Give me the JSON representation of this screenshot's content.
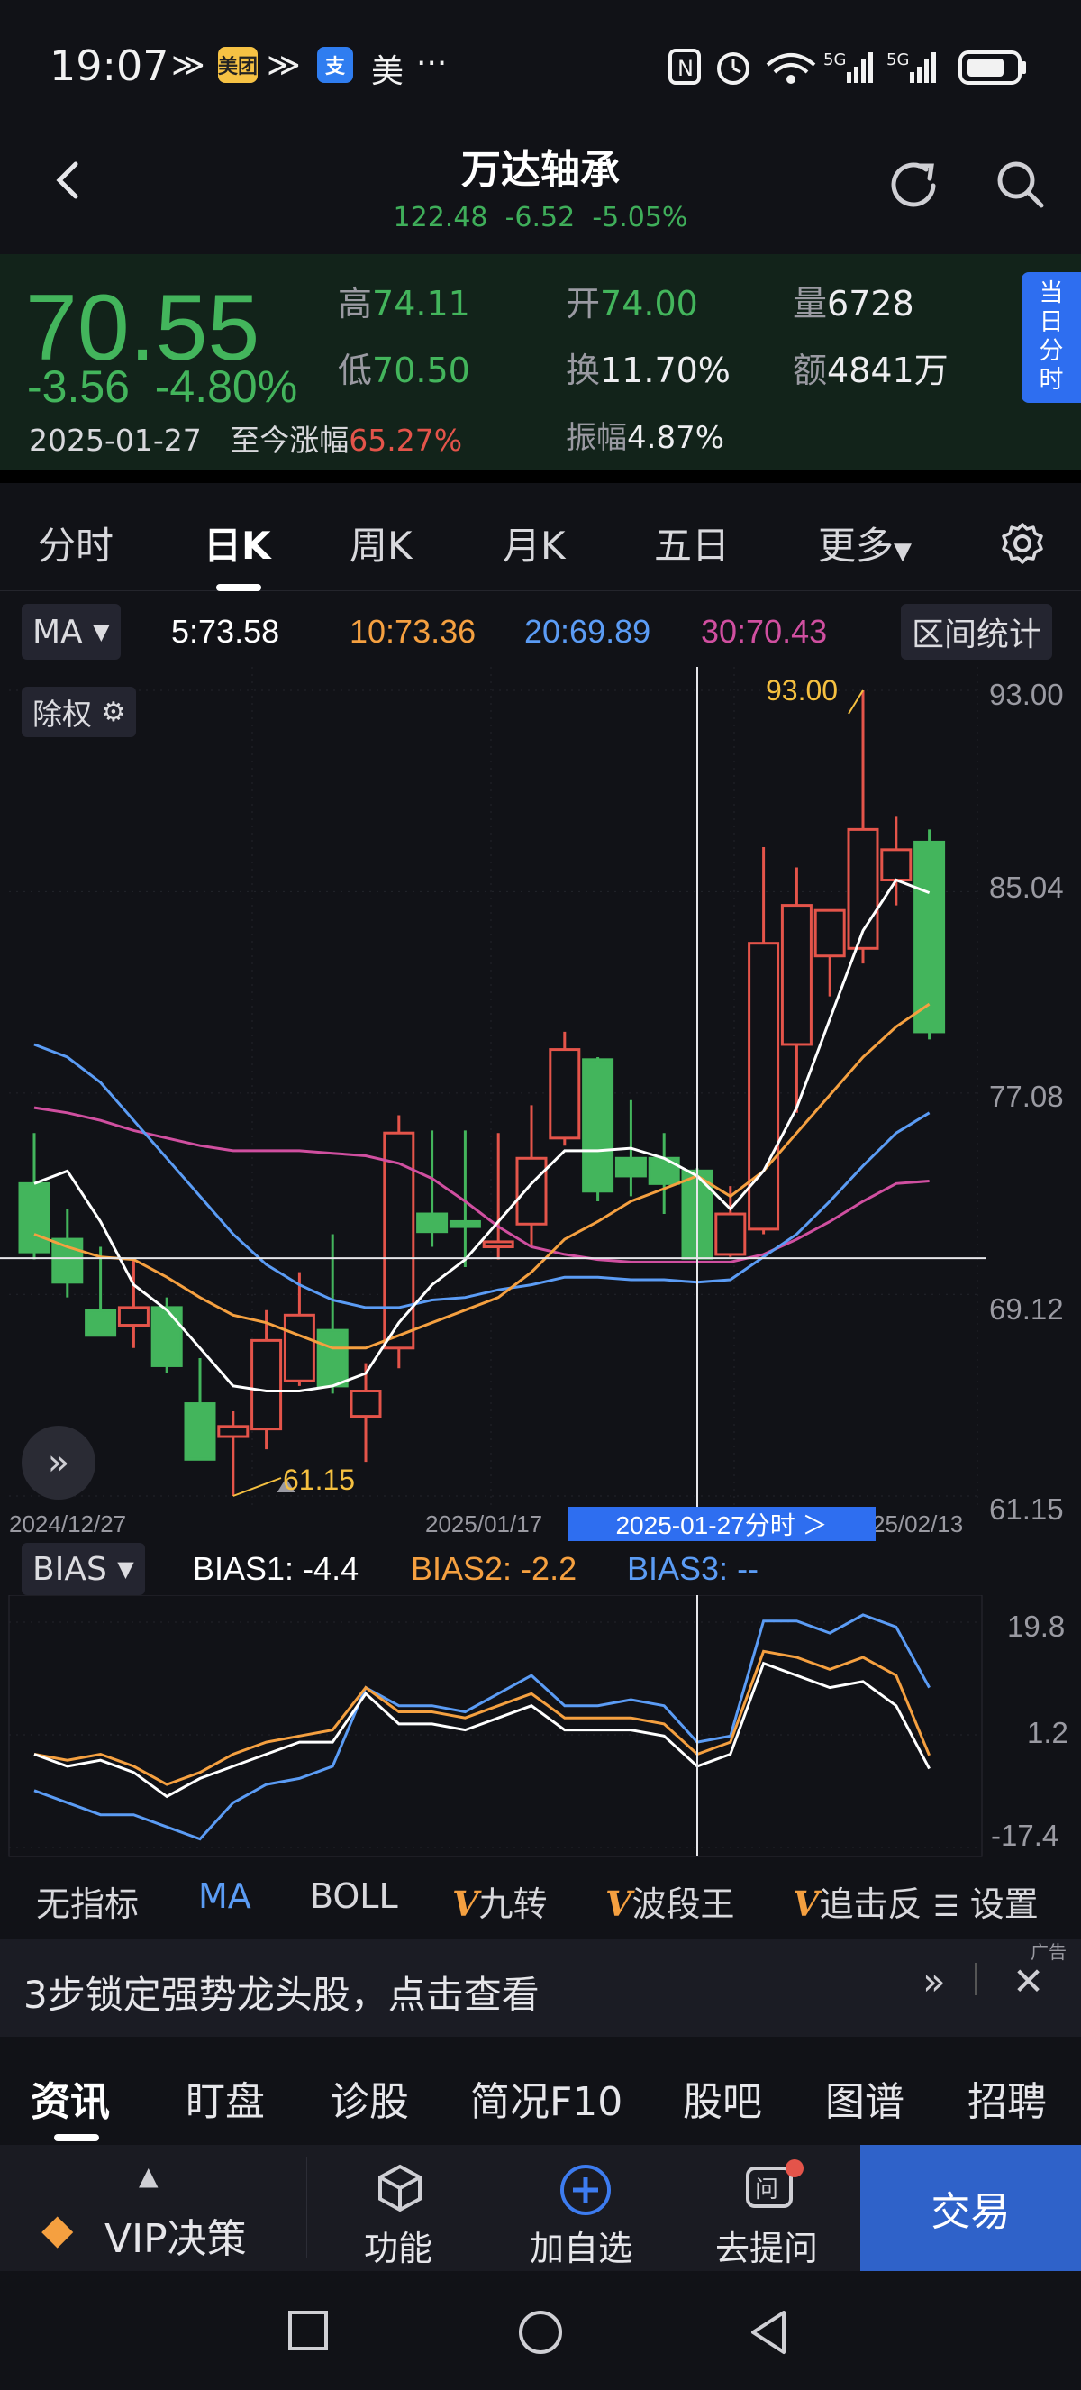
{
  "status_bar": {
    "time": "19:07",
    "app_badge_1": "美团",
    "app_badge_2": "支",
    "app_text": "美",
    "more": "···",
    "icons": [
      "nfc-icon",
      "alarm-icon",
      "wifi-icon",
      "signal-5g-icon",
      "signal-5g-icon",
      "battery-icon"
    ]
  },
  "header": {
    "stock_name": "万达轴承",
    "index_value": "122.48",
    "index_change": "-6.52",
    "index_pct": "-5.05%"
  },
  "quote": {
    "price": "70.55",
    "change": "-3.56",
    "change_pct": "-4.80%",
    "date": "2025-01-27",
    "since_label": "至今涨幅",
    "since_value": "65.27%",
    "high_label": "高",
    "high": "74.11",
    "low_label": "低",
    "low": "70.50",
    "open_label": "开",
    "open": "74.00",
    "turnover_label": "换",
    "turnover": "11.70%",
    "amplitude_label": "振幅",
    "amplitude": "4.87%",
    "volume_label": "量",
    "volume": "6728",
    "amount_label": "额",
    "amount": "4841万",
    "side_tab": [
      "当",
      "日",
      "分",
      "时"
    ]
  },
  "tabs": [
    "分时",
    "日K",
    "周K",
    "月K",
    "五日",
    "更多"
  ],
  "ma": {
    "selector": "MA",
    "ma5": "5:73.58",
    "ma10": "10:73.36",
    "ma20": "20:69.89",
    "ma30": "30:70.43",
    "range_stats": "区间统计"
  },
  "chart_controls": {
    "adjust": "除权",
    "max_label": "93.00",
    "min_label": "61.15",
    "date_start": "2024/12/27",
    "date_mid": "2025/01/17",
    "date_end": "25/02/13",
    "crosshair_date": "2025-01-27分时 ＞"
  },
  "price_axis": [
    "93.00",
    "85.04",
    "77.08",
    "69.12",
    "61.15"
  ],
  "bias": {
    "selector": "BIAS",
    "bias1": "BIAS1: -4.4",
    "bias2": "BIAS2: -2.2",
    "bias3": "BIAS3: --",
    "axis": [
      "19.8",
      "1.2",
      "-17.4"
    ]
  },
  "indicators": [
    "无指标",
    "MA",
    "BOLL",
    "九转",
    "波段王",
    "追击反",
    "设置"
  ],
  "ad": {
    "tag": "广告",
    "text": "3步锁定强势龙头股，点击查看"
  },
  "news_tabs": [
    "资讯",
    "盯盘",
    "诊股",
    "简况F10",
    "股吧",
    "图谱",
    "招聘"
  ],
  "bottom_bar": {
    "vip": "VIP决策",
    "func": "功能",
    "add": "加自选",
    "ask": "去提问",
    "trade": "交易"
  },
  "colors": {
    "up": "#e4544a",
    "down": "#43b55c",
    "ma5": "#ffffff",
    "ma10": "#f5a040",
    "ma20": "#5b9cf5",
    "ma30": "#d04fa0",
    "accent": "#2e6ef0"
  },
  "chart_data": {
    "type": "candlestick",
    "ylim": [
      61.15,
      93.0
    ],
    "candles": [
      {
        "o": 73.5,
        "h": 75.5,
        "l": 70.5,
        "c": 70.8
      },
      {
        "o": 71.3,
        "h": 72.5,
        "l": 69.0,
        "c": 69.6
      },
      {
        "o": 68.5,
        "h": 71.0,
        "l": 67.5,
        "c": 67.5
      },
      {
        "o": 67.9,
        "h": 70.5,
        "l": 67.0,
        "c": 68.6
      },
      {
        "o": 68.6,
        "h": 69.0,
        "l": 66.0,
        "c": 66.3
      },
      {
        "o": 64.8,
        "h": 66.6,
        "l": 62.6,
        "c": 62.6
      },
      {
        "o": 63.5,
        "h": 64.5,
        "l": 61.15,
        "c": 63.9
      },
      {
        "o": 63.8,
        "h": 68.5,
        "l": 63.0,
        "c": 67.3
      },
      {
        "o": 65.7,
        "h": 70.0,
        "l": 65.5,
        "c": 68.3
      },
      {
        "o": 67.7,
        "h": 71.5,
        "l": 65.2,
        "c": 65.5
      },
      {
        "o": 64.3,
        "h": 66.4,
        "l": 62.5,
        "c": 65.3
      },
      {
        "o": 67.0,
        "h": 76.2,
        "l": 66.2,
        "c": 75.5
      },
      {
        "o": 72.3,
        "h": 75.6,
        "l": 71.0,
        "c": 71.6
      },
      {
        "o": 72.0,
        "h": 75.6,
        "l": 70.2,
        "c": 71.8
      },
      {
        "o": 71.0,
        "h": 75.5,
        "l": 70.5,
        "c": 71.2
      },
      {
        "o": 71.9,
        "h": 76.6,
        "l": 71.0,
        "c": 74.5
      },
      {
        "o": 75.3,
        "h": 79.5,
        "l": 75.0,
        "c": 78.8
      },
      {
        "o": 78.4,
        "h": 78.5,
        "l": 72.8,
        "c": 73.2
      },
      {
        "o": 74.5,
        "h": 76.8,
        "l": 73.0,
        "c": 73.8
      },
      {
        "o": 74.5,
        "h": 75.5,
        "l": 72.3,
        "c": 73.5
      },
      {
        "o": 74.0,
        "h": 74.11,
        "l": 70.5,
        "c": 70.55
      },
      {
        "o": 70.7,
        "h": 73.4,
        "l": 70.6,
        "c": 72.3
      },
      {
        "o": 71.7,
        "h": 86.8,
        "l": 71.5,
        "c": 83.0
      },
      {
        "o": 79.0,
        "h": 86.0,
        "l": 76.3,
        "c": 84.5
      },
      {
        "o": 82.5,
        "h": 84.0,
        "l": 80.9,
        "c": 84.3
      },
      {
        "o": 82.8,
        "h": 93.0,
        "l": 82.2,
        "c": 87.5
      },
      {
        "o": 85.5,
        "h": 88.0,
        "l": 84.5,
        "c": 86.7
      },
      {
        "o": 87.0,
        "h": 87.5,
        "l": 79.2,
        "c": 79.5
      }
    ],
    "ma5": [
      73.5,
      74.0,
      72.0,
      69.5,
      68.5,
      67.0,
      65.5,
      65.3,
      65.3,
      65.5,
      66.0,
      68.0,
      69.5,
      70.5,
      72.0,
      73.5,
      74.8,
      74.8,
      74.9,
      74.5,
      73.8,
      72.5,
      74.0,
      76.5,
      80.0,
      83.5,
      85.5,
      85.0
    ],
    "ma10": [
      71.5,
      71.0,
      70.6,
      70.5,
      69.8,
      69.0,
      68.3,
      68.0,
      67.5,
      67.0,
      67.0,
      67.5,
      68.0,
      68.5,
      69.0,
      70.0,
      71.3,
      72.0,
      72.8,
      73.3,
      73.8,
      73.0,
      74.0,
      75.5,
      77.0,
      78.5,
      79.7,
      80.6
    ],
    "ma20": [
      79.0,
      78.5,
      77.5,
      76.0,
      74.5,
      73.0,
      71.5,
      70.3,
      69.5,
      68.9,
      68.6,
      68.6,
      68.9,
      69.0,
      69.3,
      69.5,
      69.8,
      69.8,
      69.7,
      69.7,
      69.6,
      69.7,
      70.6,
      71.5,
      72.8,
      74.2,
      75.5,
      76.3
    ],
    "ma30": [
      76.5,
      76.3,
      76.0,
      75.6,
      75.3,
      75.0,
      74.8,
      74.8,
      74.8,
      74.7,
      74.6,
      74.3,
      73.7,
      72.8,
      71.8,
      71.0,
      70.7,
      70.5,
      70.4,
      70.4,
      70.4,
      70.4,
      70.7,
      71.3,
      72.0,
      72.8,
      73.5,
      73.6
    ],
    "bias_ylim": [
      -17.4,
      19.8
    ],
    "bias1": [
      -2,
      -4,
      -3,
      -5,
      -9,
      -6,
      -4,
      -2,
      0,
      0,
      8,
      3,
      3,
      2,
      4,
      6,
      2,
      2,
      2,
      1,
      -4,
      -2,
      13,
      11,
      9,
      10,
      6,
      -4.4
    ],
    "bias2": [
      -2,
      -3,
      -2,
      -4,
      -7,
      -5,
      -2,
      0,
      1,
      2,
      9,
      5,
      5,
      4,
      6,
      8,
      4,
      4,
      4,
      3,
      -2,
      0,
      15,
      14,
      12,
      14,
      11,
      -2.2
    ],
    "bias3": [
      -8,
      -10,
      -12,
      -12,
      -14,
      -16,
      -10,
      -7,
      -6,
      -4,
      9,
      6,
      6,
      5,
      8,
      11,
      6,
      6,
      7,
      6,
      0,
      1,
      20,
      20,
      18,
      21,
      19,
      9
    ]
  }
}
